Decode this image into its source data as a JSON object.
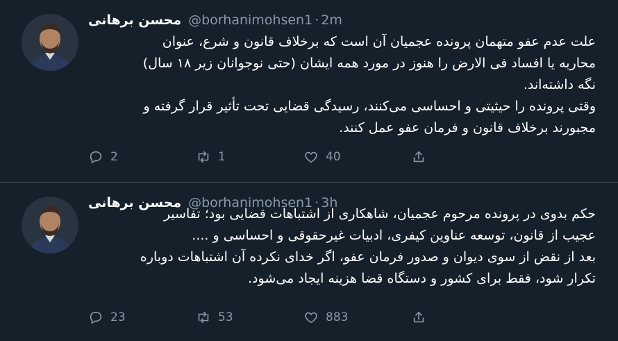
{
  "tweets": [
    {
      "author": {
        "display_name": "محسن برهانی",
        "handle": "@borhanimohsen1"
      },
      "separator": "·",
      "time": "2m",
      "text_lines": [
        "علت عدم عفو متهمان پرونده عجمیان آن است که برخلاف قانون و شرع، عنوان",
        "محاربه یا افساد فی الارض را هنوز در مورد همه ایشان (حتی نوجوانان زیر ۱۸ سال)",
        "نگه داشته‌اند.",
        "وقتی پرونده را حیثیتی و احساسی می‌کنند، رسیدگی قضایی تحت تأثیر قرار گرفته و",
        "مجبورند برخلاف قانون و فرمان عفو عمل کنند."
      ],
      "actions": {
        "replies": "2",
        "retweets": "1",
        "likes": "40"
      }
    },
    {
      "author": {
        "display_name": "محسن برهانی",
        "handle": "@borhanimohsen1"
      },
      "separator": "·",
      "time": "3h",
      "text_lines": [
        "حکم بدوی در پرونده مرحوم عجمیان، شاهکاری از اشتباهات قضایی بود؛ تفاسیر",
        "عجیب از قانون، توسعه عناوین کیفری، ادبیات غیرحقوقی و احساسی و ....",
        "بعد از نقض از سوی دیوان و صدور فرمان عفو، اگر خدای نکرده آن اشتباهات دوباره",
        "تکرار شود، فقط برای کشور و دستگاه قضا هزینه ایجاد می‌شود."
      ],
      "actions": {
        "replies": "23",
        "retweets": "53",
        "likes": "883"
      }
    }
  ],
  "icons": {
    "reply": "reply-icon",
    "retweet": "retweet-icon",
    "like": "heart-icon",
    "share": "share-icon"
  },
  "colors": {
    "background": "#15202b",
    "text": "#ffffff",
    "secondary_text": "#8899a6",
    "divider": "#38444d"
  }
}
